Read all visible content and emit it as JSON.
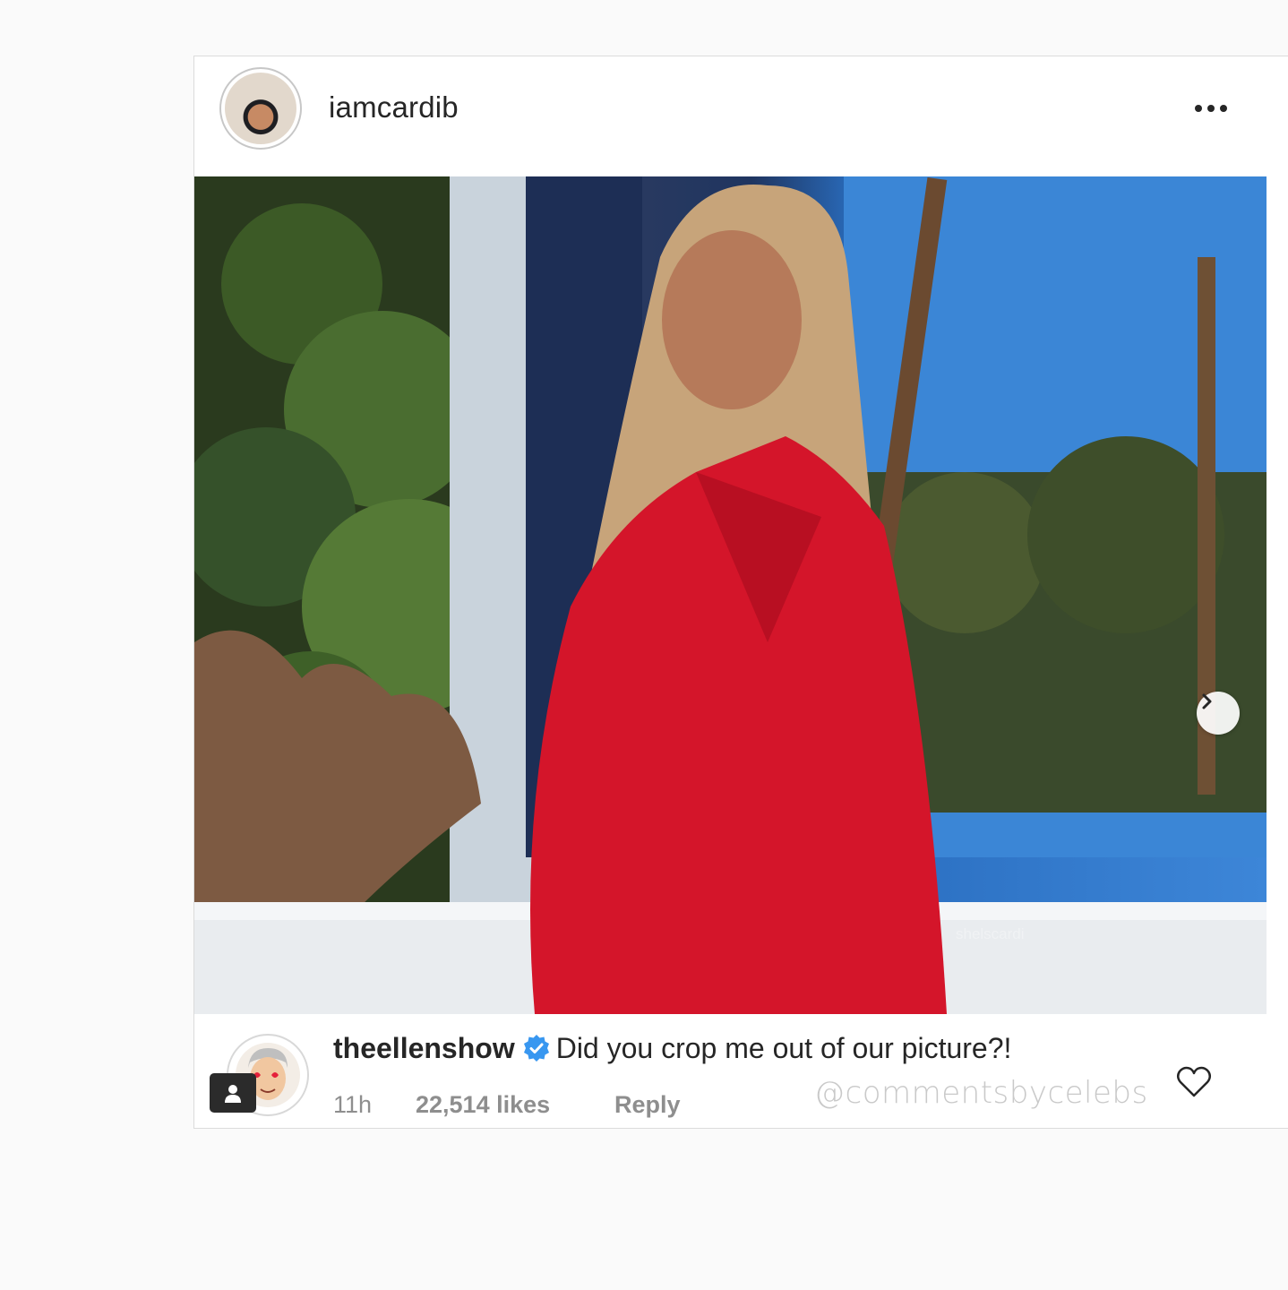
{
  "post": {
    "username": "iamcardib",
    "more_icon": "more-horizontal-icon",
    "photo_watermark": "shelscardi",
    "next_icon": "chevron-right-icon"
  },
  "comment": {
    "username": "theellenshow",
    "verified_icon": "verified-badge-icon",
    "text": "Did you crop me out of our picture?!",
    "time": "11h",
    "likes": "22,514 likes",
    "reply_label": "Reply",
    "credit_watermark": "@commentsbycelebs",
    "heart_icon": "heart-outline-icon"
  },
  "colors": {
    "text": "#262626",
    "muted": "#8e8e8e",
    "verified": "#3897f0",
    "background": "#fafafa",
    "border": "#dbdbdb"
  }
}
